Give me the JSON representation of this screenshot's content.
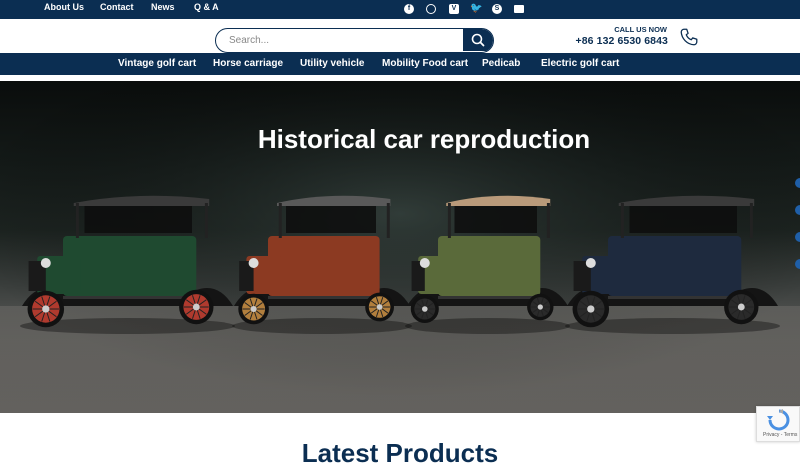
{
  "topbar": {
    "links": [
      "About Us",
      "Contact",
      "News",
      "Q & A"
    ],
    "social_icons": [
      "facebook-icon",
      "instagram-icon",
      "vimeo-icon",
      "twitter-icon",
      "skype-icon",
      "email-icon"
    ]
  },
  "header": {
    "search_placeholder": "Search...",
    "call_label": "CALL US NOW",
    "phone": "+86 132 6530 6843"
  },
  "nav": {
    "items": [
      "Vintage golf cart",
      "Horse carriage",
      "Utility vehicle",
      "Mobility Food cart",
      "Pedicab",
      "Electric golf cart"
    ]
  },
  "hero": {
    "title": "Historical car reproduction",
    "cars": [
      {
        "body": "#1f4a30",
        "roof": "#3a3a3a",
        "wheels": "#b03a2e"
      },
      {
        "body": "#8c3a22",
        "roof": "#595959",
        "wheels": "#b27f3d"
      },
      {
        "body": "#5a6a3a",
        "roof": "#b99a7a",
        "wheels": "#2a2a2a"
      },
      {
        "body": "#1e2a3e",
        "roof": "#3a3a3a",
        "wheels": "#2a2a2a"
      }
    ]
  },
  "recaptcha": {
    "text": "Privacy - Terms"
  },
  "latest": {
    "title": "Latest Products"
  },
  "colors": {
    "brand": "#0b2e52",
    "accent_dot": "#1f5fa8"
  }
}
